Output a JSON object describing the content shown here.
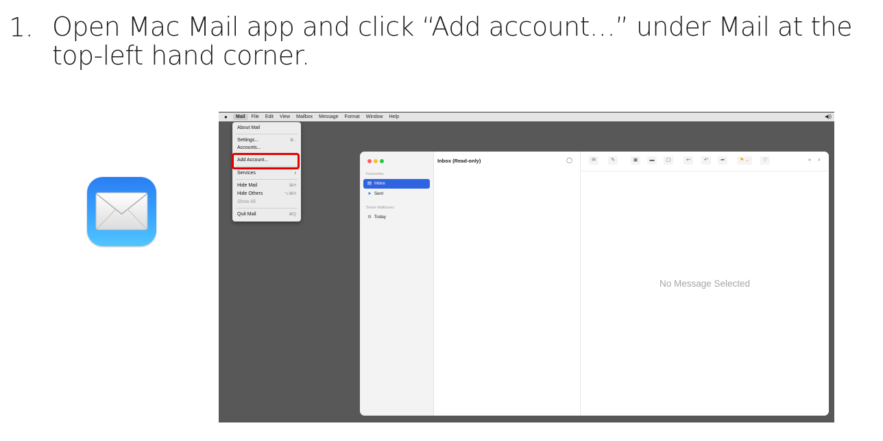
{
  "instruction": {
    "number": "1.",
    "text": "Open Mac Mail app and click “Add account…” under Mail at the top-left hand corner."
  },
  "menubar": {
    "apple": "",
    "items": [
      "Mail",
      "File",
      "Edit",
      "View",
      "Mailbox",
      "Message",
      "Format",
      "Window",
      "Help"
    ],
    "volume": "◀))"
  },
  "mail_menu": {
    "about": "About Mail",
    "settings": "Settings...",
    "settings_shortcut": "⌘ ,",
    "accounts": "Accounts...",
    "add_account": "Add Account...",
    "services": "Services",
    "services_arrow": "›",
    "hide_mail": "Hide Mail",
    "hide_mail_shortcut": "⌘H",
    "hide_others": "Hide Others",
    "hide_others_shortcut": "⌥⌘H",
    "show_all": "Show All",
    "quit": "Quit Mail",
    "quit_shortcut": "⌘Q"
  },
  "sidebar": {
    "favourites_heading": "Favourites",
    "inbox": "Inbox",
    "sent": "Sent",
    "smart_heading": "Smart Mailboxes",
    "today": "Today"
  },
  "message_list": {
    "title": "Inbox (Read-only)"
  },
  "reading_pane": {
    "empty_text": "No Message Selected",
    "more": "»",
    "search": "⌕"
  },
  "colors": {
    "selection_blue": "#2f63e0",
    "highlight_red": "#e00000",
    "close": "#ff5f57",
    "minimize": "#febc2e",
    "zoom": "#28c840"
  }
}
